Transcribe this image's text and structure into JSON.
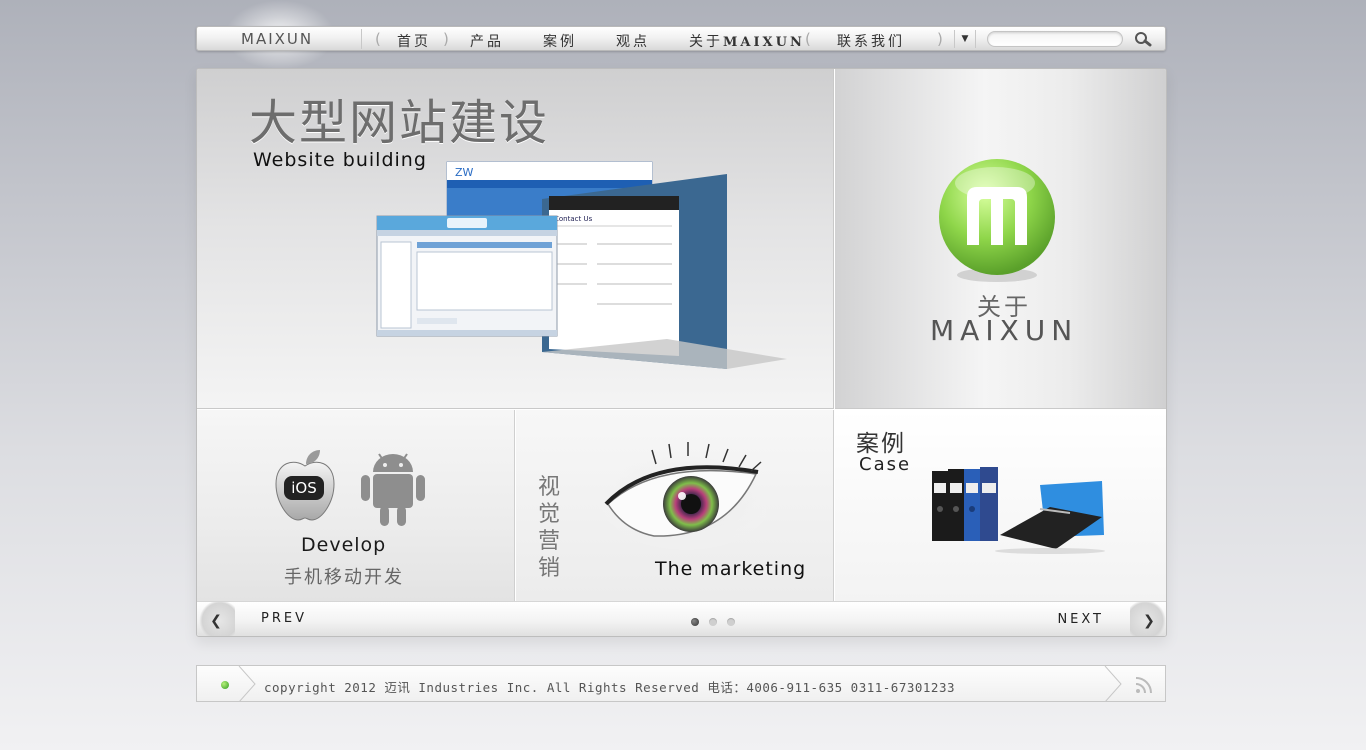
{
  "nav": {
    "logo": "MAIXUN",
    "items": [
      "首页",
      "产品",
      "案例",
      "观点",
      "关于",
      "联系我们"
    ],
    "brand": "MAIXUN",
    "search_placeholder": ""
  },
  "tiles": {
    "website": {
      "title": "大型网站建设",
      "subtitle": "Website building"
    },
    "about": {
      "label": "关于",
      "brand": "MAIXUN"
    },
    "develop": {
      "en": "Develop",
      "zh": "手机移动开发"
    },
    "visual": {
      "zh": "视觉营销",
      "en": "The marketing"
    },
    "case": {
      "zh": "案例",
      "en": "Case"
    }
  },
  "slider": {
    "prev": "PREV",
    "next": "NEXT",
    "prev_arrow": "❮",
    "next_arrow": "❯",
    "dot_count": 3,
    "active_index": 0
  },
  "footer": {
    "text": "copyright 2012 迈讯 Industries Inc. All Rights Reserved 电话：4006-911-635 0311-67301233"
  },
  "colors": {
    "accent_green": "#8fd64a",
    "brand_gray": "#555555"
  }
}
